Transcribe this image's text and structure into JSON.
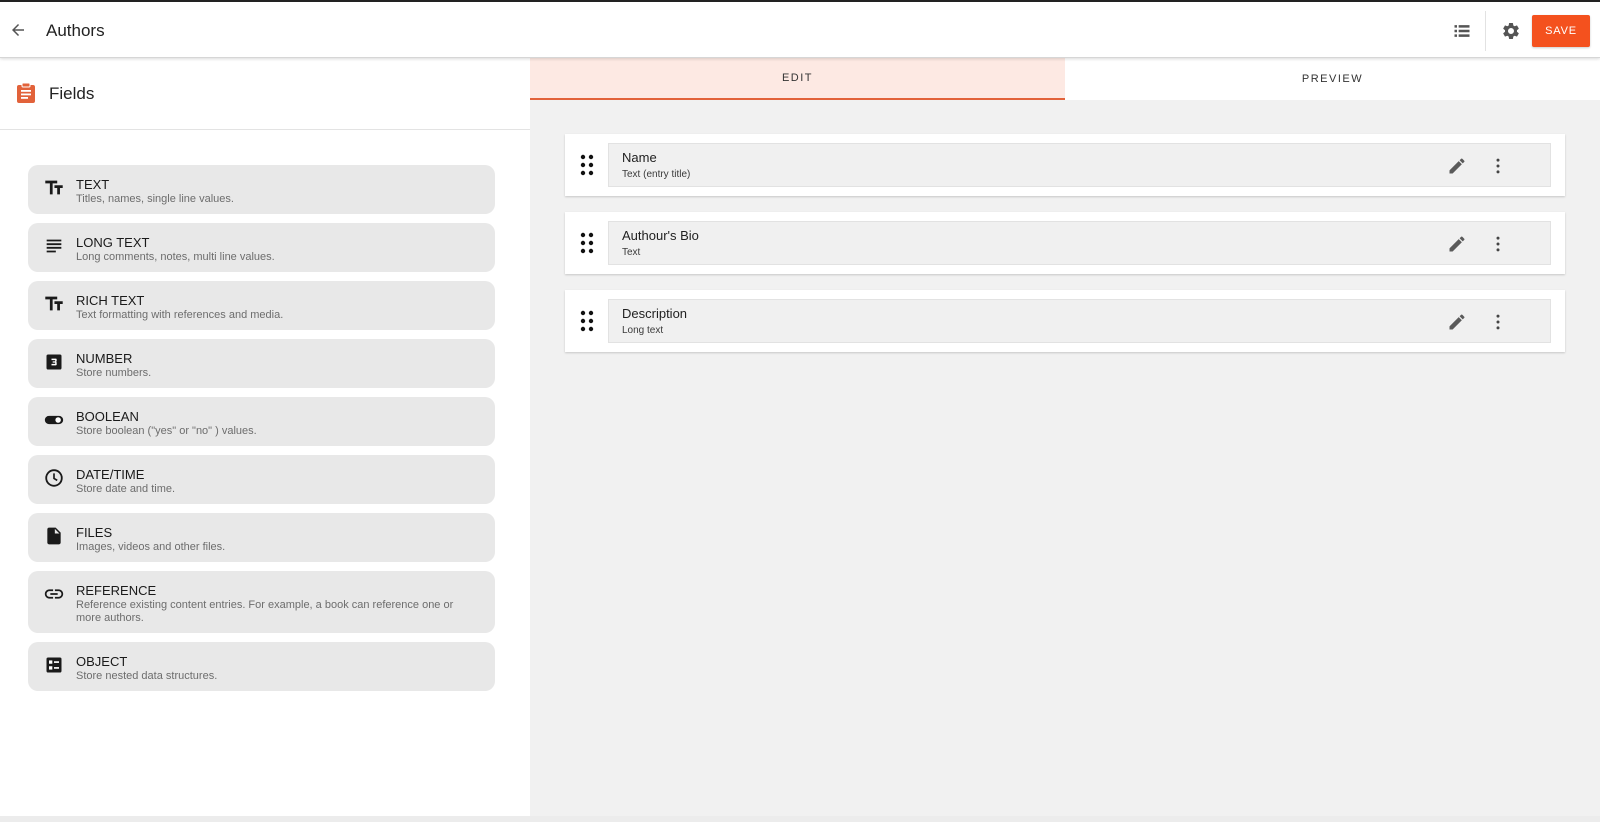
{
  "header": {
    "title": "Authors",
    "save_label": "SAVE",
    "icons": {
      "back": "arrow-back-icon",
      "list": "view-list-icon",
      "settings": "gear-icon"
    }
  },
  "sidebar": {
    "title": "Fields",
    "icon": "clipboard-icon",
    "field_types": [
      {
        "label": "TEXT",
        "description": "Titles, names, single line values.",
        "icon": "text-fields-icon"
      },
      {
        "label": "LONG TEXT",
        "description": "Long comments, notes, multi line values.",
        "icon": "subject-lines-icon"
      },
      {
        "label": "RICH TEXT",
        "description": "Text formatting with references and media.",
        "icon": "text-fields-icon"
      },
      {
        "label": "NUMBER",
        "description": "Store numbers.",
        "icon": "number-3-icon"
      },
      {
        "label": "BOOLEAN",
        "description": "Store boolean (\"yes\" or \"no\" ) values.",
        "icon": "toggle-icon"
      },
      {
        "label": "DATE/TIME",
        "description": "Store date and time.",
        "icon": "clock-icon"
      },
      {
        "label": "FILES",
        "description": "Images, videos and other files.",
        "icon": "file-icon"
      },
      {
        "label": "REFERENCE",
        "description": "Reference existing content entries. For example, a book can reference one or more authors.",
        "icon": "link-icon"
      },
      {
        "label": "OBJECT",
        "description": "Store nested data structures.",
        "icon": "object-list-icon"
      }
    ]
  },
  "tabs": [
    {
      "label": "EDIT",
      "active": true
    },
    {
      "label": "PREVIEW",
      "active": false
    }
  ],
  "fields": [
    {
      "name": "Name",
      "type": "Text (entry title)"
    },
    {
      "name": "Authour's Bio",
      "type": "Text"
    },
    {
      "name": "Description",
      "type": "Long text"
    }
  ],
  "colors": {
    "accent": "#f4511e",
    "active_tab_bg": "#fde9e3",
    "active_tab_border": "#e2623a",
    "card_bg": "#e8e8e8",
    "canvas_bg": "#f1f1f1"
  }
}
